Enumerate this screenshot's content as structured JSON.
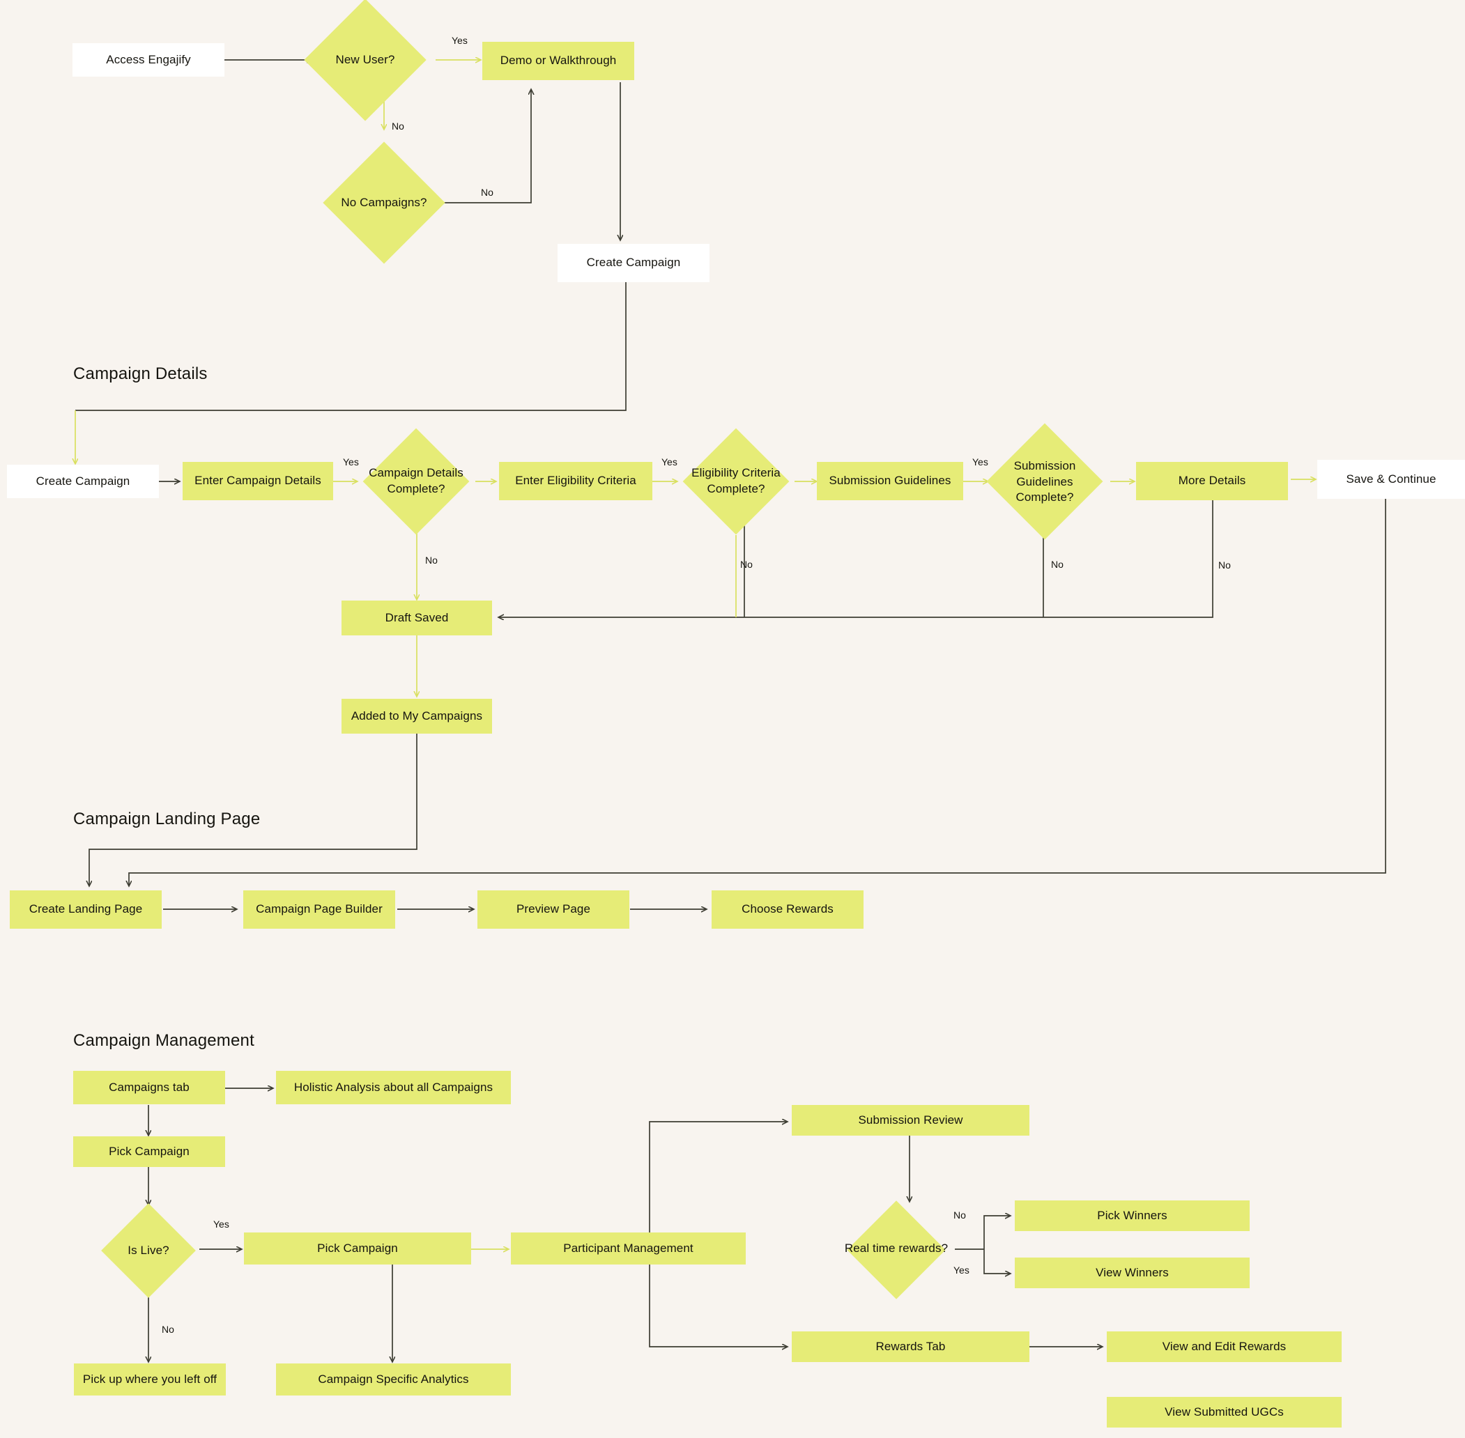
{
  "diagram": {
    "title": "Engajify Campaign User Flow",
    "background_color": "#f8f4ef",
    "node_fill": "#e6ec77",
    "node_fill_alt": "#ffffff",
    "edge_color_dark": "#3c3c32",
    "edge_color_light": "#d9e05f",
    "text_color": "#15140f"
  },
  "sections": [
    {
      "id": "campaign_details",
      "label": "Campaign Details"
    },
    {
      "id": "landing_page",
      "label": "Campaign Landing Page"
    },
    {
      "id": "campaign_mgmt",
      "label": "Campaign Management"
    }
  ],
  "nodes": [
    {
      "id": "access_engajify",
      "label": "Access Engajify",
      "shape": "rect",
      "fill": "white"
    },
    {
      "id": "new_user",
      "label": "New User?",
      "shape": "diamond",
      "fill": "yellow"
    },
    {
      "id": "demo_walkthrough",
      "label": "Demo or Walkthrough",
      "shape": "rect",
      "fill": "yellow"
    },
    {
      "id": "no_campaigns",
      "label": "No Campaigns?",
      "shape": "diamond",
      "fill": "yellow"
    },
    {
      "id": "create_campaign_top",
      "label": "Create Campaign",
      "shape": "rect",
      "fill": "white"
    },
    {
      "id": "create_campaign",
      "label": "Create Campaign",
      "shape": "rect",
      "fill": "white"
    },
    {
      "id": "enter_campaign_details",
      "label": "Enter Campaign Details",
      "shape": "rect",
      "fill": "yellow"
    },
    {
      "id": "campaign_details_complete",
      "label": "Campaign Details Complete?",
      "shape": "diamond",
      "fill": "yellow"
    },
    {
      "id": "enter_eligibility",
      "label": "Enter Eligibility Criteria",
      "shape": "rect",
      "fill": "yellow"
    },
    {
      "id": "eligibility_complete",
      "label": "Eligibility Criteria Complete?",
      "shape": "diamond",
      "fill": "yellow"
    },
    {
      "id": "submission_guidelines",
      "label": "Submission Guidelines",
      "shape": "rect",
      "fill": "yellow"
    },
    {
      "id": "submission_guidelines_complete",
      "label": "Submission Guidelines Complete?",
      "shape": "diamond",
      "fill": "yellow"
    },
    {
      "id": "more_details",
      "label": "More Details",
      "shape": "rect",
      "fill": "yellow"
    },
    {
      "id": "save_continue",
      "label": "Save & Continue",
      "shape": "rect",
      "fill": "white"
    },
    {
      "id": "draft_saved",
      "label": "Draft Saved",
      "shape": "rect",
      "fill": "yellow"
    },
    {
      "id": "added_my_campaigns",
      "label": "Added to My Campaigns",
      "shape": "rect",
      "fill": "yellow"
    },
    {
      "id": "create_landing_page",
      "label": "Create Landing Page",
      "shape": "rect",
      "fill": "yellow"
    },
    {
      "id": "campaign_page_builder",
      "label": "Campaign Page Builder",
      "shape": "rect",
      "fill": "yellow"
    },
    {
      "id": "preview_page",
      "label": "Preview Page",
      "shape": "rect",
      "fill": "yellow"
    },
    {
      "id": "choose_rewards",
      "label": "Choose Rewards",
      "shape": "rect",
      "fill": "yellow"
    },
    {
      "id": "campaigns_tab",
      "label": "Campaigns tab",
      "shape": "rect",
      "fill": "yellow"
    },
    {
      "id": "holistic_analysis",
      "label": "Holistic Analysis about all Campaigns",
      "shape": "rect",
      "fill": "yellow"
    },
    {
      "id": "pick_campaign",
      "label": "Pick Campaign",
      "shape": "rect",
      "fill": "yellow"
    },
    {
      "id": "is_live",
      "label": "Is Live?",
      "shape": "diamond",
      "fill": "yellow"
    },
    {
      "id": "pick_campaign_2",
      "label": "Pick Campaign",
      "shape": "rect",
      "fill": "yellow"
    },
    {
      "id": "participant_management",
      "label": "Participant Management",
      "shape": "rect",
      "fill": "yellow"
    },
    {
      "id": "pick_up_left_off",
      "label": "Pick up where you left off",
      "shape": "rect",
      "fill": "yellow"
    },
    {
      "id": "campaign_specific_analytics",
      "label": "Campaign Specific Analytics",
      "shape": "rect",
      "fill": "yellow"
    },
    {
      "id": "submission_review",
      "label": "Submission Review",
      "shape": "rect",
      "fill": "yellow"
    },
    {
      "id": "real_time_rewards",
      "label": "Real time rewards?",
      "shape": "diamond",
      "fill": "yellow"
    },
    {
      "id": "pick_winners",
      "label": "Pick Winners",
      "shape": "rect",
      "fill": "yellow"
    },
    {
      "id": "view_winners",
      "label": "View Winners",
      "shape": "rect",
      "fill": "yellow"
    },
    {
      "id": "rewards_tab",
      "label": "Rewards Tab",
      "shape": "rect",
      "fill": "yellow"
    },
    {
      "id": "view_edit_rewards",
      "label": "View and Edit Rewards",
      "shape": "rect",
      "fill": "yellow"
    },
    {
      "id": "view_submitted_ugcs",
      "label": "View Submitted UGCs",
      "shape": "rect",
      "fill": "yellow"
    }
  ],
  "edge_labels": [
    {
      "id": "new_user_yes",
      "text": "Yes"
    },
    {
      "id": "new_user_no",
      "text": "No"
    },
    {
      "id": "no_campaigns_no",
      "text": "No"
    },
    {
      "id": "campaign_details_yes",
      "text": "Yes"
    },
    {
      "id": "campaign_details_no",
      "text": "No"
    },
    {
      "id": "eligibility_yes",
      "text": "Yes"
    },
    {
      "id": "eligibility_no",
      "text": "No"
    },
    {
      "id": "submission_guidelines_yes",
      "text": "Yes"
    },
    {
      "id": "submission_guidelines_no",
      "text": "No"
    },
    {
      "id": "more_details_no",
      "text": "No"
    },
    {
      "id": "is_live_yes",
      "text": "Yes"
    },
    {
      "id": "is_live_no",
      "text": "No"
    },
    {
      "id": "real_time_no",
      "text": "No"
    },
    {
      "id": "real_time_yes",
      "text": "Yes"
    }
  ]
}
